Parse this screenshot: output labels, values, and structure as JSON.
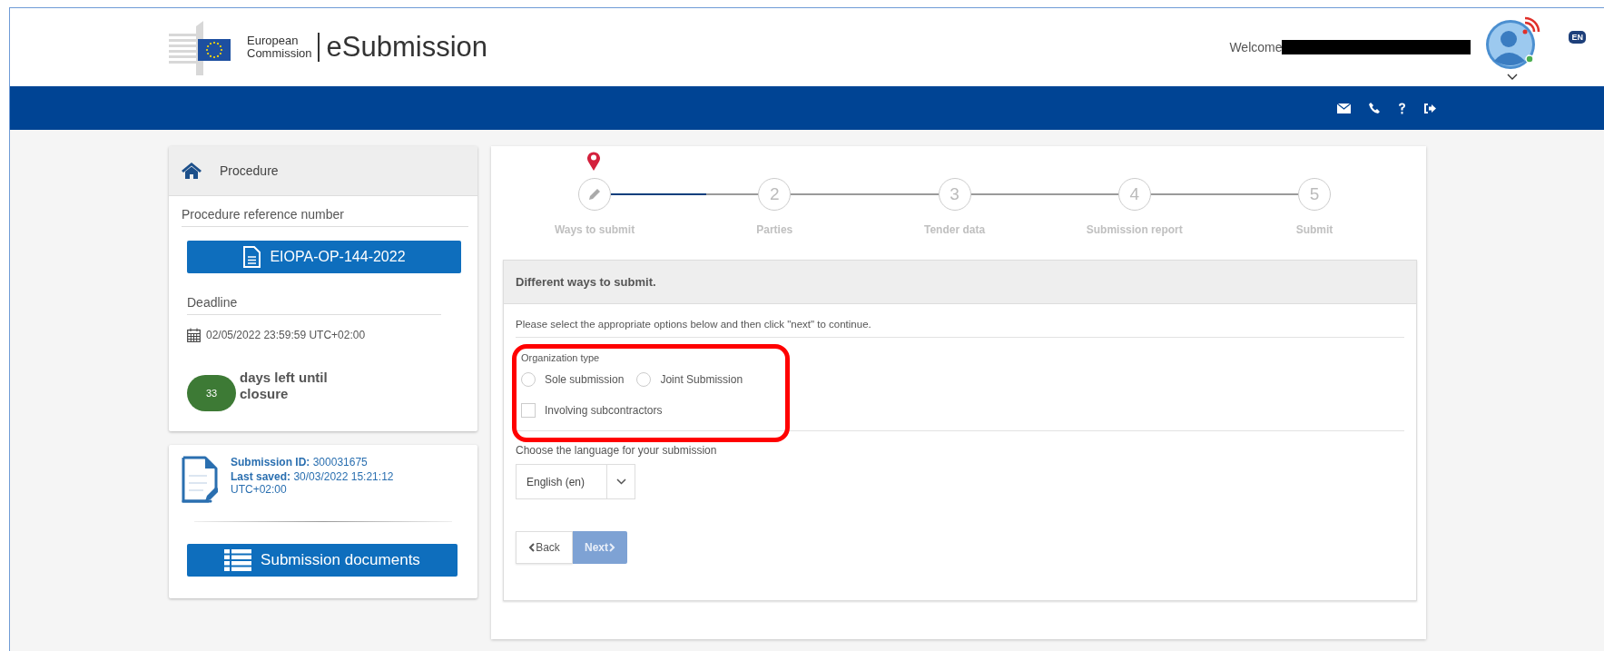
{
  "header": {
    "org_line_1": "European",
    "org_line_2": "Commission",
    "app_title": "eSubmission",
    "welcome": "Welcome",
    "language": "EN"
  },
  "procedure_card": {
    "title": "Procedure",
    "reference_label": "Procedure reference number",
    "reference": "EIOPA-OP-144-2022",
    "deadline_label": "Deadline",
    "deadline": "02/05/2022 23:59:59 UTC+02:00",
    "days_left": "33",
    "days_left_text": "days left until closure"
  },
  "submission_card": {
    "id_label": "Submission ID:",
    "id": "300031675",
    "saved_label": "Last saved:",
    "saved": "30/03/2022 15:21:12 UTC+02:00",
    "documents_button": "Submission documents"
  },
  "steps": [
    {
      "label": "Ways to submit",
      "current": true
    },
    {
      "label": "Parties",
      "number": "2",
      "current": false
    },
    {
      "label": "Tender data",
      "number": "3",
      "current": false
    },
    {
      "label": "Submission report",
      "number": "4",
      "current": false
    },
    {
      "label": "Submit",
      "number": "5",
      "current": false
    }
  ],
  "form": {
    "title": "Different ways to submit.",
    "intro": "Please select the appropriate options below and then click \"next\" to continue.",
    "organization_label": "Organization type",
    "organization_options": [
      {
        "label": "Sole submission",
        "selected": false
      },
      {
        "label": "Joint Submission",
        "selected": false
      }
    ],
    "subcontractors": {
      "label": "Involving subcontractors",
      "checked": false
    },
    "language_label": "Choose the language for your submission",
    "language_value": "English (en)",
    "back_button": "Back",
    "next_button": {
      "label": "Next",
      "disabled": true
    }
  }
}
